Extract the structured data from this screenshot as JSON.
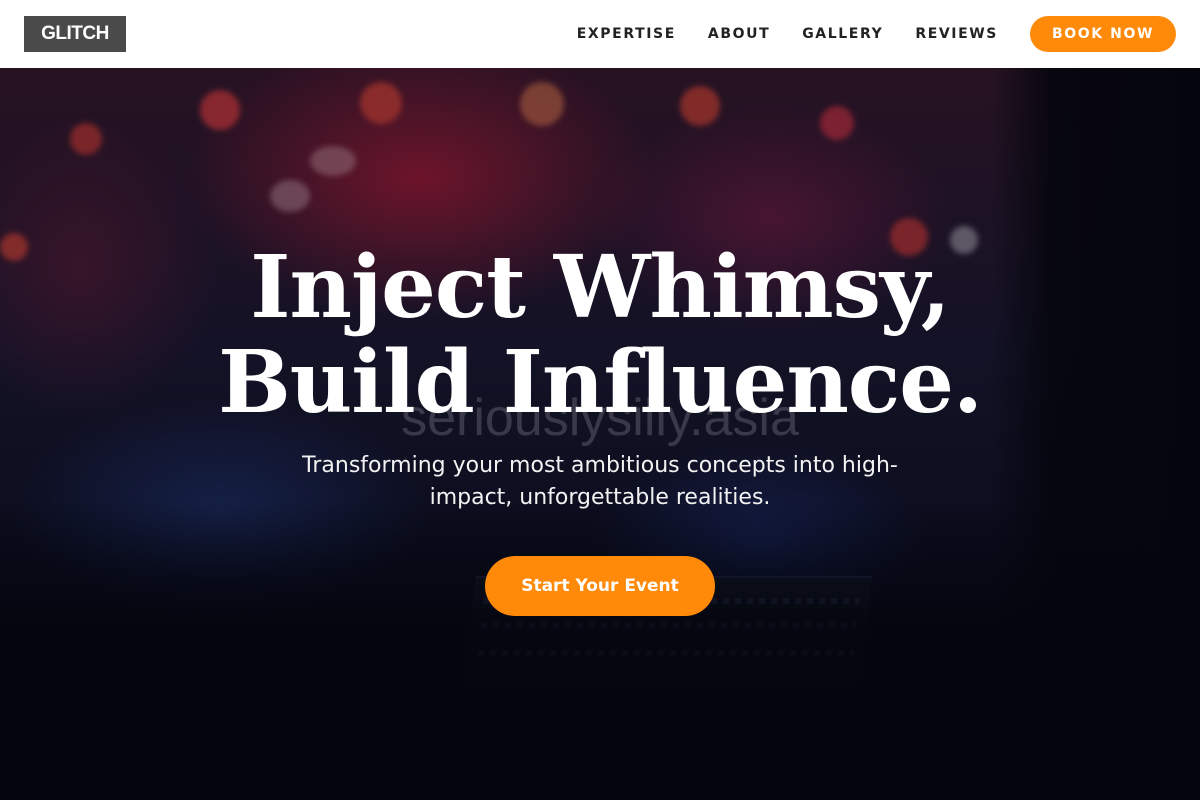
{
  "nav": {
    "logo": "GLITCH",
    "links": [
      "EXPERTISE",
      "ABOUT",
      "GALLERY",
      "REVIEWS"
    ],
    "cta_label": "BOOK NOW"
  },
  "hero": {
    "headline_line1": "Inject Whimsy,",
    "headline_line2": "Build Influence.",
    "subtitle": "Transforming your most ambitious concepts into high-impact, unforgettable realities.",
    "cta_label": "Start Your Event",
    "watermark": "seriouslysilly.asia"
  },
  "colors": {
    "accent": "#ff8a0a",
    "logo_bg": "#4a4a4a",
    "nav_bg": "#ffffff",
    "hero_text": "#ffffff"
  }
}
